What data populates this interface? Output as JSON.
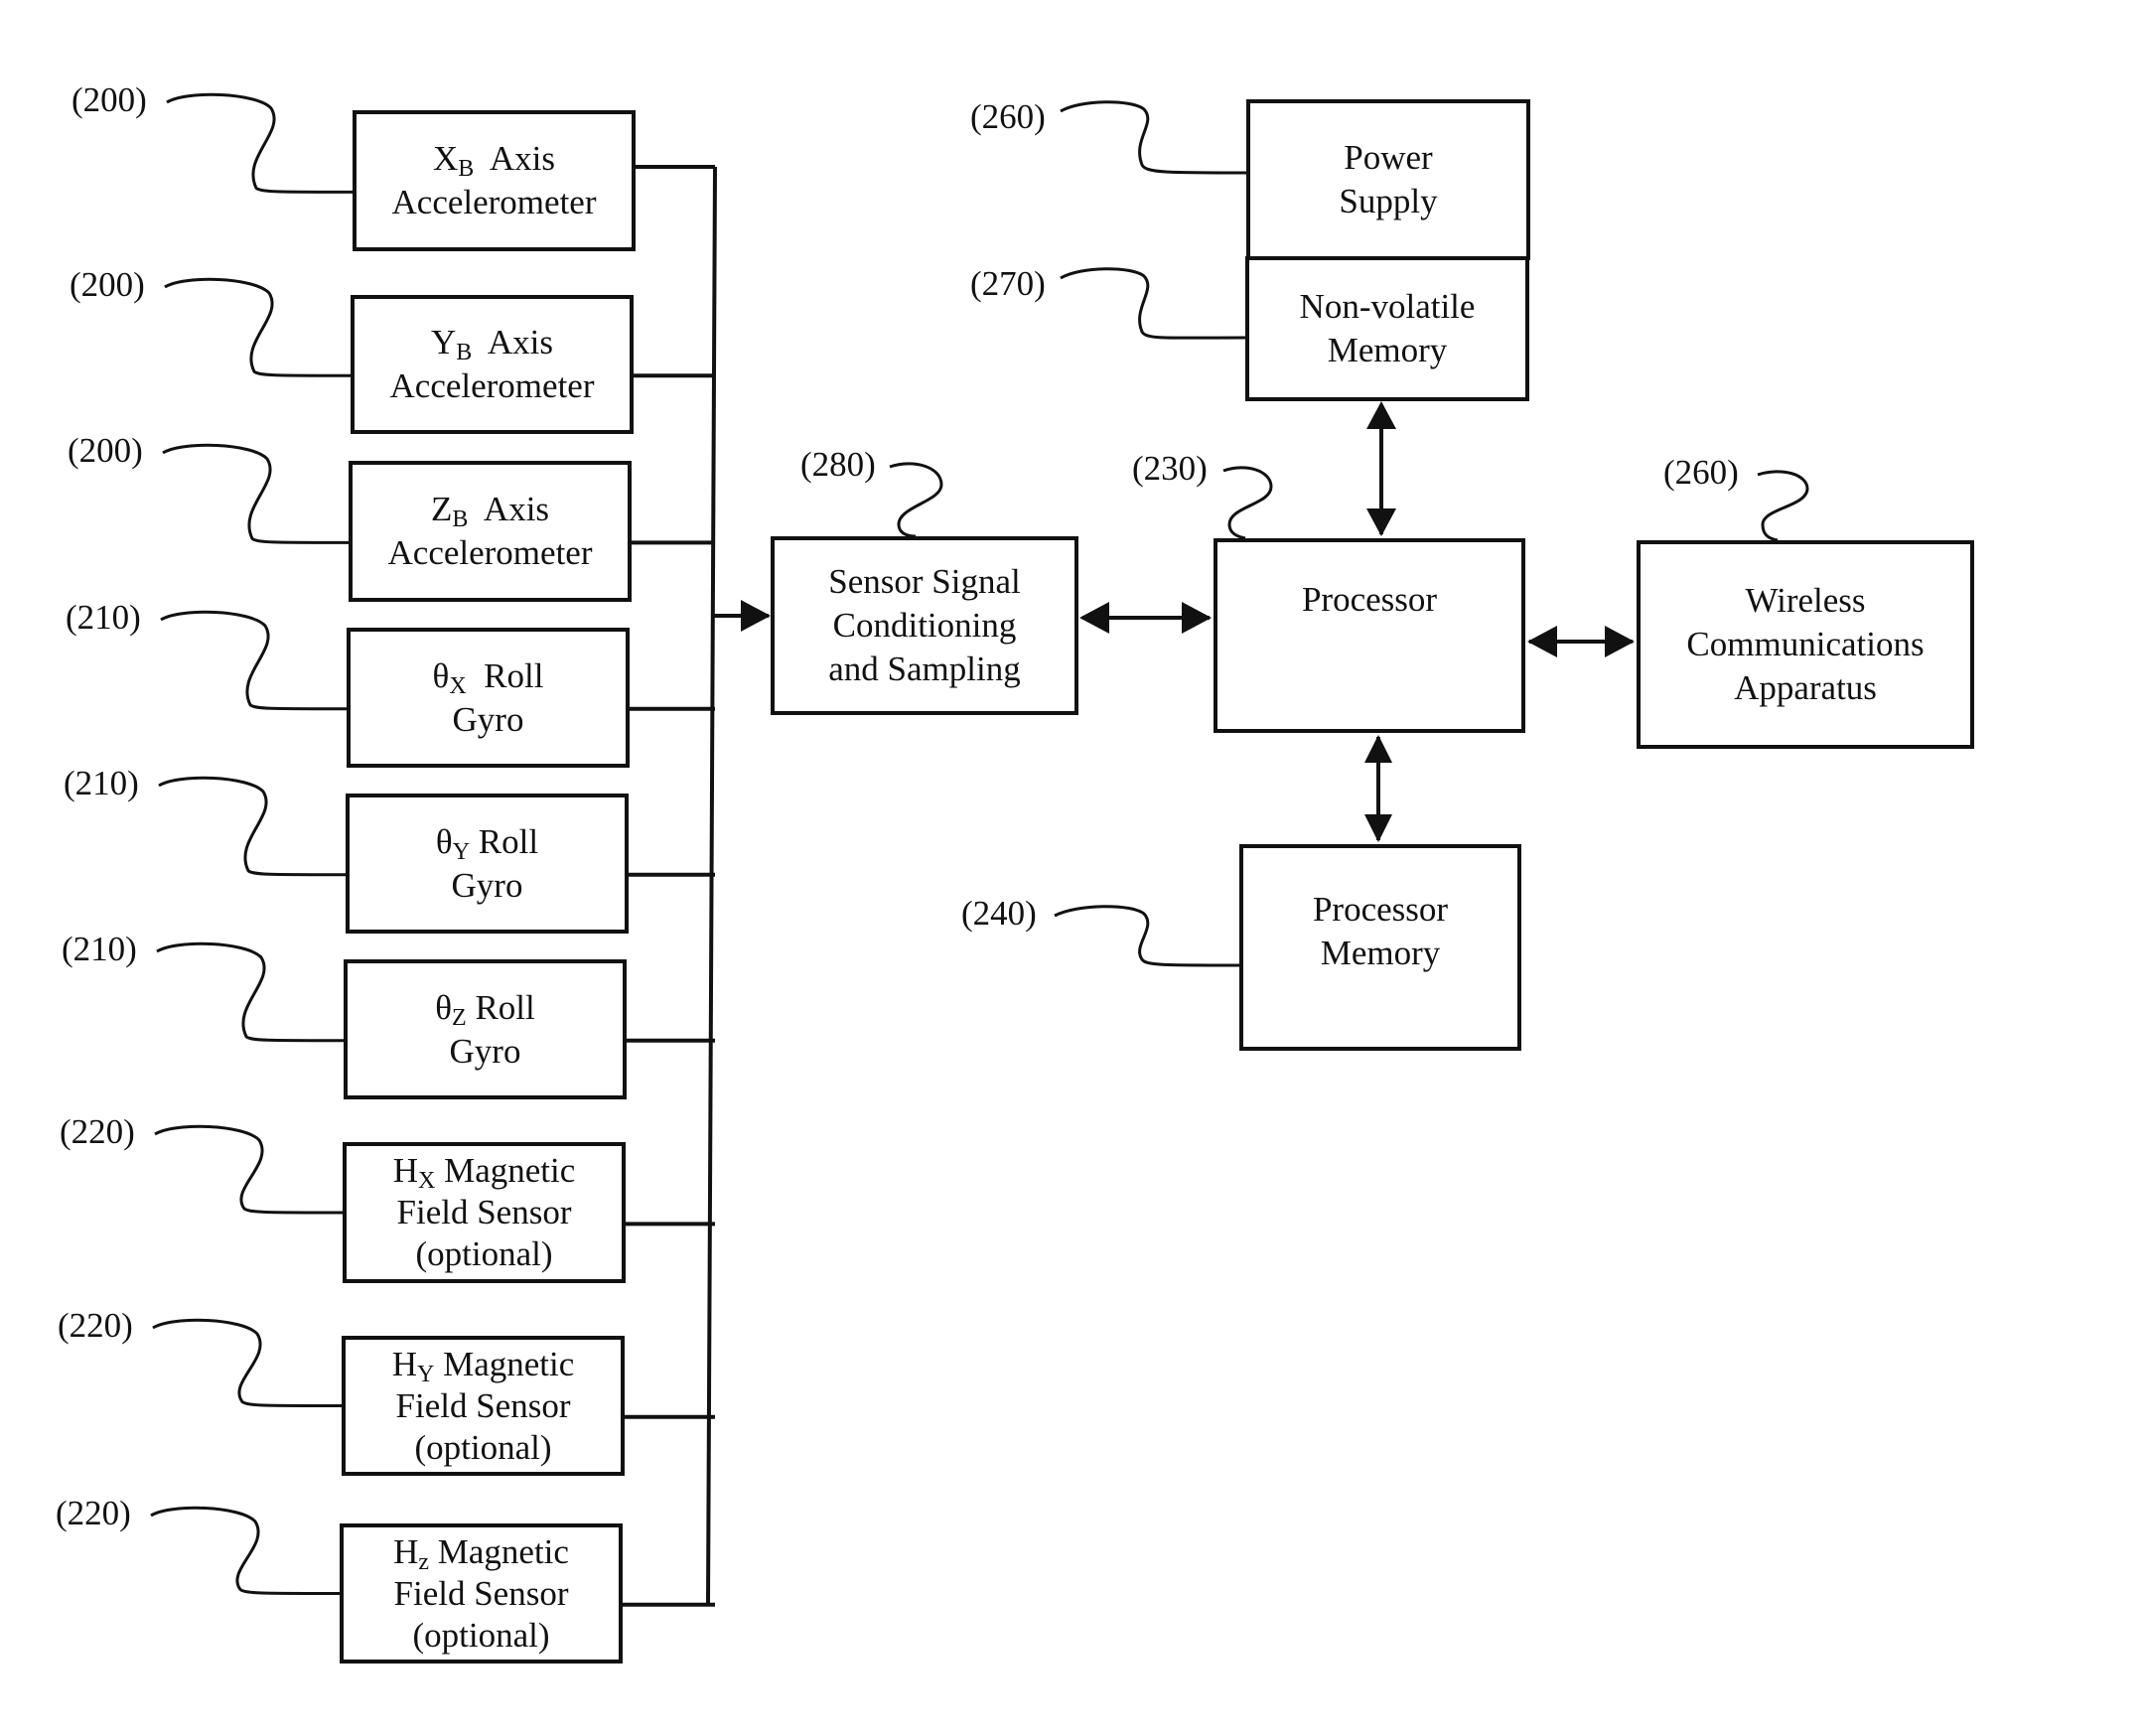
{
  "diagram": {
    "sensors": [
      {
        "ref": "(200)",
        "sym": "X",
        "sub": "B",
        "line1_rest": "  Axis",
        "line2": "Accelerometer",
        "line3": ""
      },
      {
        "ref": "(200)",
        "sym": "Y",
        "sub": "B",
        "line1_rest": "  Axis",
        "line2": "Accelerometer",
        "line3": ""
      },
      {
        "ref": "(200)",
        "sym": "Z",
        "sub": "B",
        "line1_rest": "  Axis",
        "line2": "Accelerometer",
        "line3": ""
      },
      {
        "ref": "(210)",
        "sym": "θ",
        "sub": "X",
        "line1_rest": "  Roll",
        "line2": "Gyro",
        "line3": ""
      },
      {
        "ref": "(210)",
        "sym": "θ",
        "sub": "Y",
        "line1_rest": " Roll",
        "line2": "Gyro",
        "line3": ""
      },
      {
        "ref": "(210)",
        "sym": "θ",
        "sub": "Z",
        "line1_rest": " Roll",
        "line2": "Gyro",
        "line3": ""
      },
      {
        "ref": "(220)",
        "sym": "H",
        "sub": "X",
        "line1_rest": " Magnetic",
        "line2": "Field Sensor",
        "line3": "(optional)"
      },
      {
        "ref": "(220)",
        "sym": "H",
        "sub": "Y",
        "line1_rest": " Magnetic",
        "line2": "Field Sensor",
        "line3": "(optional)"
      },
      {
        "ref": "(220)",
        "sym": "H",
        "sub": "z",
        "line1_rest": " Magnetic",
        "line2": "Field Sensor",
        "line3": "(optional)"
      }
    ],
    "conditioning": {
      "ref": "(280)",
      "lines": [
        "Sensor Signal",
        "Conditioning",
        "and Sampling"
      ]
    },
    "processor": {
      "ref": "(230)",
      "label": "Processor"
    },
    "power_supply": {
      "ref": "(260)",
      "lines": [
        "Power",
        "Supply"
      ]
    },
    "nonvolatile_memory": {
      "ref": "(270)",
      "lines": [
        "Non-volatile",
        "Memory"
      ]
    },
    "wireless": {
      "ref": "(260)",
      "lines": [
        "Wireless",
        "Communications",
        "Apparatus"
      ]
    },
    "processor_memory": {
      "ref": "(240)",
      "lines": [
        "Processor",
        "Memory"
      ]
    }
  }
}
